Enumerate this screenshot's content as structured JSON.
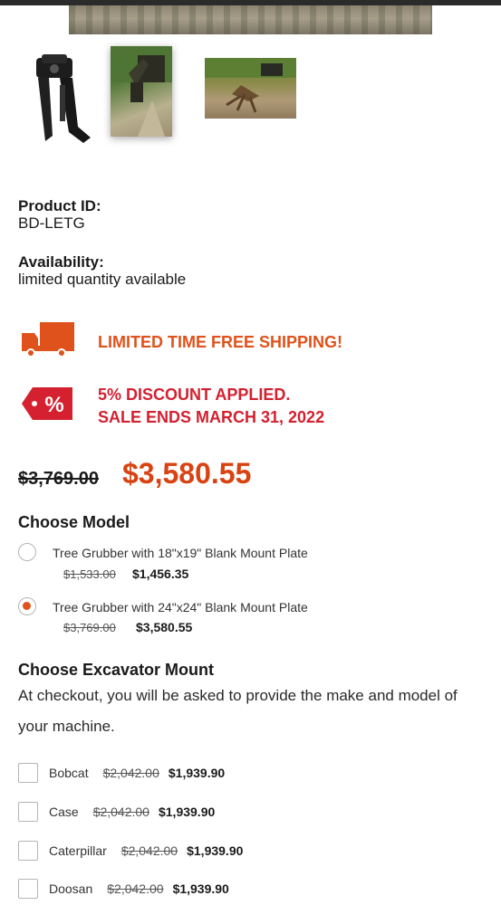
{
  "product": {
    "id_label": "Product ID:",
    "id_value": "BD-LETG",
    "availability_label": "Availability:",
    "availability_value": "limited quantity available"
  },
  "promos": {
    "shipping": "LIMITED TIME FREE SHIPPING!",
    "discount_line1": "5% DISCOUNT APPLIED.",
    "discount_line2": "SALE ENDS MARCH 31, 2022",
    "discount_badge": "%"
  },
  "price": {
    "old": "$3,769.00",
    "new": "$3,580.55"
  },
  "model": {
    "title": "Choose Model",
    "options": [
      {
        "label": "Tree Grubber with 18\"x19\" Blank Mount Plate",
        "old": "$1,533.00",
        "new": "$1,456.35",
        "selected": false
      },
      {
        "label": "Tree Grubber with 24\"x24\" Blank Mount Plate",
        "old": "$3,769.00",
        "new": "$3,580.55",
        "selected": true
      }
    ]
  },
  "mount": {
    "title": "Choose Excavator Mount",
    "helper": "At checkout, you will be asked to provide the make and model of your machine.",
    "options": [
      {
        "name": "Bobcat",
        "old": "$2,042.00",
        "new": "$1,939.90"
      },
      {
        "name": "Case",
        "old": "$2,042.00",
        "new": "$1,939.90"
      },
      {
        "name": "Caterpillar",
        "old": "$2,042.00",
        "new": "$1,939.90"
      },
      {
        "name": "Doosan",
        "old": "$2,042.00",
        "new": "$1,939.90"
      }
    ]
  },
  "colors": {
    "accent_orange": "#e0521b",
    "accent_red": "#d4202f",
    "price_orange": "#d84312"
  }
}
